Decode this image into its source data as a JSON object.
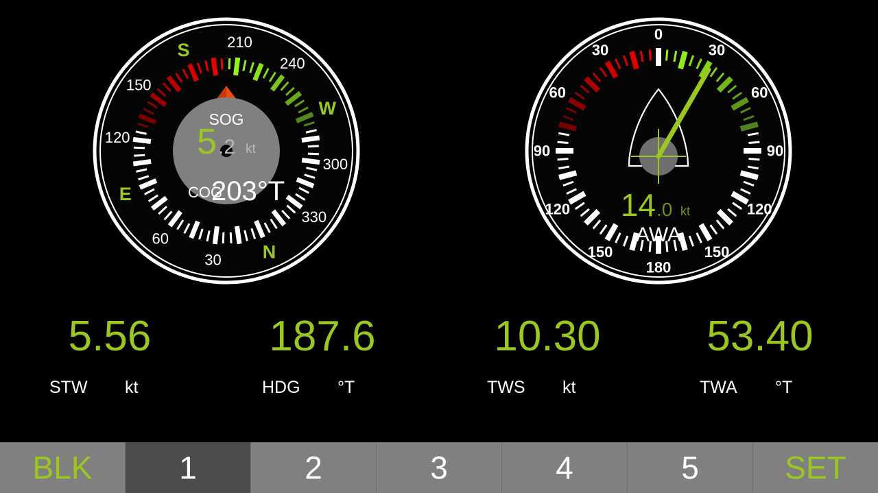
{
  "screen": {
    "background": "#000000",
    "accent_green": "#9bc721",
    "white": "#ffffff",
    "red": "#e00000",
    "orange": "#ef4b10",
    "hub_gray": "#808080"
  },
  "compass_gauge": {
    "name": "compass-rose",
    "heading_up": 203,
    "pointer_color": "#ef4b10",
    "hub_color": "#808080",
    "center": {
      "sog_label": "SOG",
      "sog_whole": "5",
      "sog_frac": ".2",
      "sog_unit": "kt",
      "cog_label": "COG",
      "cog_value": "203°T"
    },
    "ring_labels": [
      {
        "text": "210",
        "bearing": 210,
        "kind": "number"
      },
      {
        "text": "240",
        "bearing": 240,
        "kind": "number"
      },
      {
        "text": "W",
        "bearing": 270,
        "kind": "cardinal"
      },
      {
        "text": "300",
        "bearing": 300,
        "kind": "number"
      },
      {
        "text": "330",
        "bearing": 330,
        "kind": "number"
      },
      {
        "text": "N",
        "bearing": 0,
        "kind": "cardinal"
      },
      {
        "text": "30",
        "bearing": 30,
        "kind": "number"
      },
      {
        "text": "60",
        "bearing": 60,
        "kind": "number"
      },
      {
        "text": "E",
        "bearing": 90,
        "kind": "cardinal"
      },
      {
        "text": "120",
        "bearing": 120,
        "kind": "number"
      },
      {
        "text": "150",
        "bearing": 150,
        "kind": "number"
      },
      {
        "text": "S",
        "bearing": 180,
        "kind": "cardinal"
      }
    ]
  },
  "wind_gauge": {
    "name": "apparent-wind-angle-dial",
    "needle_angle_deg": 30,
    "needle_color": "#9bc721",
    "center": {
      "speed_whole": "14",
      "speed_frac": ".0",
      "speed_unit": "kt",
      "caption": "AWA"
    },
    "ring_labels": [
      {
        "text": "0",
        "angle": 0
      },
      {
        "text": "30",
        "angle": 30
      },
      {
        "text": "60",
        "angle": 60
      },
      {
        "text": "90",
        "angle": 90
      },
      {
        "text": "120",
        "angle": 120
      },
      {
        "text": "150",
        "angle": 150
      },
      {
        "text": "180",
        "angle": 180
      },
      {
        "text": "150",
        "angle": -150
      },
      {
        "text": "120",
        "angle": -120
      },
      {
        "text": "90",
        "angle": -90
      },
      {
        "text": "60",
        "angle": -60
      },
      {
        "text": "30",
        "angle": -30
      }
    ]
  },
  "readouts": [
    {
      "value": "5.56",
      "name": "STW",
      "unit": "kt"
    },
    {
      "value": "187.6",
      "name": "HDG",
      "unit": "°T"
    },
    {
      "value": "10.30",
      "name": "TWS",
      "unit": "kt"
    },
    {
      "value": "53.40",
      "name": "TWA",
      "unit": "°T"
    }
  ],
  "toolbar": {
    "buttons": [
      {
        "label": "BLK",
        "accent": true,
        "selected": false
      },
      {
        "label": "1",
        "accent": false,
        "selected": true
      },
      {
        "label": "2",
        "accent": false,
        "selected": false
      },
      {
        "label": "3",
        "accent": false,
        "selected": false
      },
      {
        "label": "4",
        "accent": false,
        "selected": false
      },
      {
        "label": "5",
        "accent": false,
        "selected": false
      },
      {
        "label": "SET",
        "accent": true,
        "selected": false
      }
    ]
  }
}
